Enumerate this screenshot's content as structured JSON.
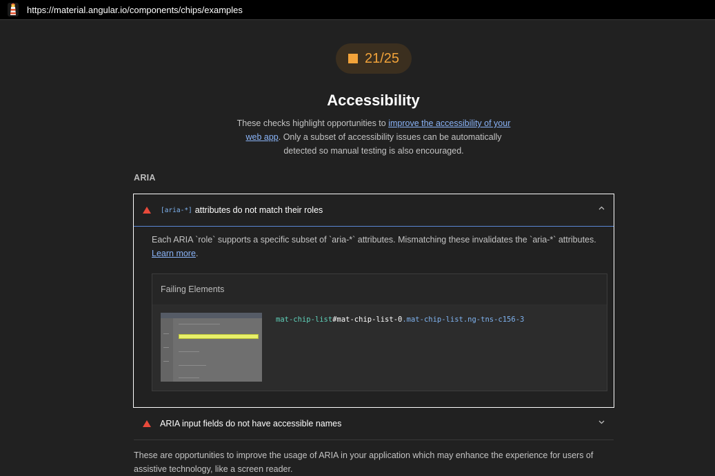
{
  "browser": {
    "url": "https://material.angular.io/components/chips/examples"
  },
  "category": {
    "score": "21/25",
    "title": "Accessibility",
    "desc_before": "These checks highlight opportunities to ",
    "desc_link": "improve the accessibility of your web app",
    "desc_after": ". Only a subset of accessibility issues can be automatically detected so manual testing is also encouraged."
  },
  "group": {
    "title": "ARIA",
    "description": "These are opportunities to improve the usage of ARIA in your application which may enhance the experience for users of assistive technology, like a screen reader."
  },
  "audits": [
    {
      "code": "[aria-*]",
      "title": "attributes do not match their roles",
      "description": "Each ARIA `role` supports a specific subset of `aria-*` attributes. Mismatching these invalidates the `aria-*` attributes. ",
      "learn_more": "Learn more",
      "failing_label": "Failing Elements",
      "node": {
        "tag": "mat-chip-list",
        "id": "#mat-chip-list-0",
        "classes": ".mat-chip-list.ng-tns-c156-3"
      }
    },
    {
      "title": "ARIA input fields do not have accessible names"
    }
  ],
  "colors": {
    "warn": "#e84a3b",
    "average": "#f2a33a",
    "link": "#8ab4f8"
  }
}
